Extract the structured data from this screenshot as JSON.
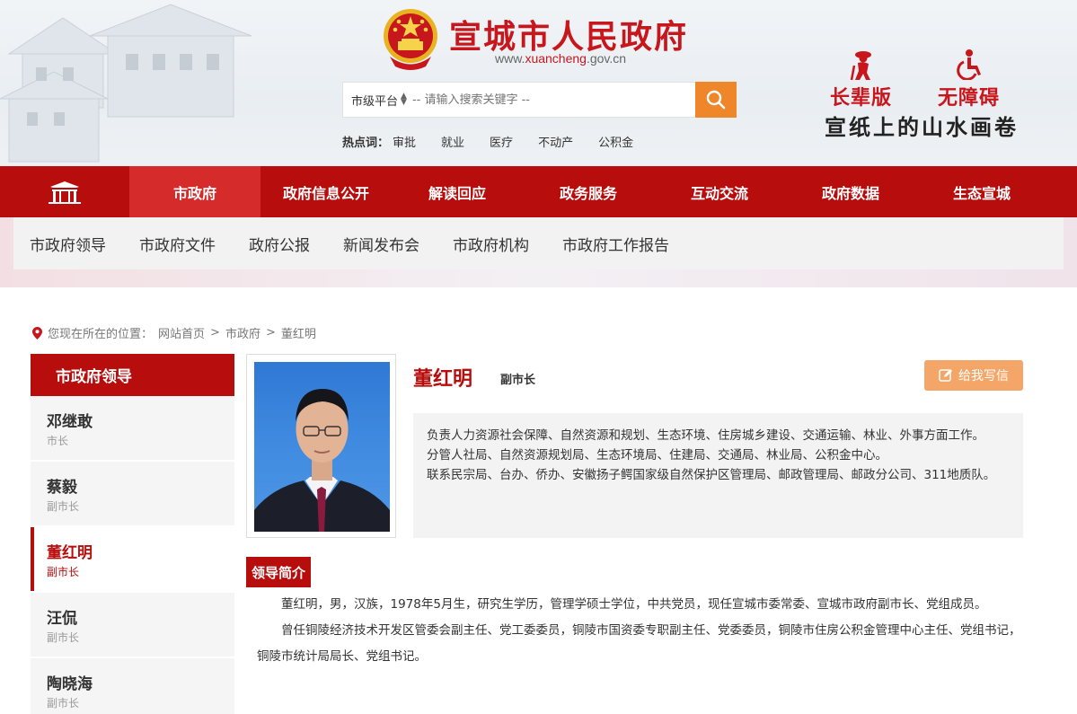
{
  "header": {
    "site_title": "宣城市人民政府",
    "site_url_prefix": "www.",
    "site_url_mid": "xuancheng",
    "site_url_suffix": ".gov.cn",
    "search": {
      "scope": "市级平台",
      "placeholder": "-- 请输入搜索关键字 --"
    },
    "hotwords_label": "热点词：",
    "hotwords": [
      "审批",
      "就业",
      "医疗",
      "不动产",
      "公积金"
    ],
    "elder_mode": "长辈版",
    "accessible_mode": "无障碍",
    "slogan": "宣纸上的山水画卷"
  },
  "main_nav": [
    "市政府",
    "政府信息公开",
    "解读回应",
    "政务服务",
    "互动交流",
    "政府数据",
    "生态宣城"
  ],
  "sub_nav": [
    "市政府领导",
    "市政府文件",
    "政府公报",
    "新闻发布会",
    "市政府机构",
    "市政府工作报告"
  ],
  "breadcrumb": {
    "prefix": "您现在所在的位置：",
    "items": [
      "网站首页",
      "市政府",
      "董红明"
    ],
    "sep": ">"
  },
  "sidebar": {
    "title": "市政府领导",
    "items": [
      {
        "name": "邓继敢",
        "title": "市长"
      },
      {
        "name": "蔡毅",
        "title": "副市长"
      },
      {
        "name": "董红明",
        "title": "副市长"
      },
      {
        "name": "汪侃",
        "title": "副市长"
      },
      {
        "name": "陶晓海",
        "title": "副市长"
      }
    ]
  },
  "profile": {
    "name": "董红明",
    "title": "副市长",
    "write_button": "给我写信",
    "duties": [
      "负责人力资源社会保障、自然资源和规划、生态环境、住房城乡建设、交通运输、林业、外事方面工作。",
      "分管人社局、自然资源规划局、生态环境局、住建局、交通局、林业局、公积金中心。",
      "联系民宗局、台办、侨办、安徽扬子鳄国家级自然保护区管理局、邮政管理局、邮政分公司、311地质队。"
    ],
    "bio_title": "领导简介",
    "bio": [
      "董红明，男，汉族，1978年5月生，研究生学历，管理学硕士学位，中共党员，现任宣城市委常委、宣城市政府副市长、党组成员。",
      "曾任铜陵经济技术开发区管委会副主任、党工委委员，铜陵市国资委专职副主任、党委委员，铜陵市住房公积金管理中心主任、党组书记，铜陵市统计局局长、党组书记。"
    ]
  },
  "colors": {
    "brand_red": "#b70d0d",
    "active_red": "#d62b2b",
    "search_orange": "#f0862a",
    "write_btn": "#f3a668"
  }
}
